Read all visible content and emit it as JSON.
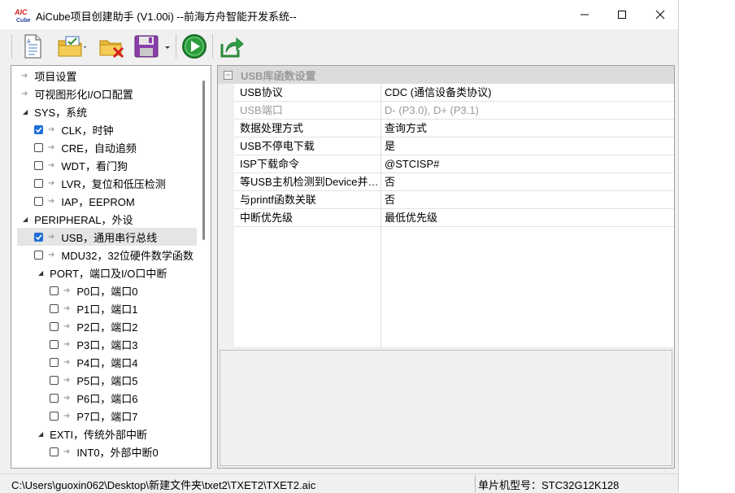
{
  "window": {
    "logo_text": "AIC Cube",
    "title": "AiCube项目创建助手 (V1.00i) --前海方舟智能开发系统--",
    "controls": [
      "minimize",
      "maximize",
      "close"
    ]
  },
  "toolbar": {
    "buttons": [
      {
        "icon": "new-document-icon"
      },
      {
        "icon": "open-folder-icon"
      },
      {
        "icon": "delete-folder-icon"
      },
      {
        "icon": "save-disk-icon"
      },
      {
        "icon": "run-play-icon"
      },
      {
        "icon": "export-share-icon"
      }
    ]
  },
  "tree": {
    "items": [
      {
        "label": "项目设置"
      },
      {
        "label": "可视图形化I/O口配置"
      },
      {
        "label": "SYS，系统"
      },
      {
        "label": "CLK，时钟",
        "checked": true
      },
      {
        "label": "CRE，自动追频",
        "checked": false
      },
      {
        "label": "WDT，看门狗",
        "checked": false
      },
      {
        "label": "LVR，复位和低压检测",
        "checked": false
      },
      {
        "label": "IAP，EEPROM",
        "checked": false
      },
      {
        "label": "PERIPHERAL，外设"
      },
      {
        "label": "USB，通用串行总线",
        "checked": true
      },
      {
        "label": "MDU32，32位硬件数学函数",
        "checked": false
      },
      {
        "label": "PORT，端口及I/O口中断"
      },
      {
        "label": "P0口，端口0",
        "checked": false
      },
      {
        "label": "P1口，端口1",
        "checked": false
      },
      {
        "label": "P2口，端口2",
        "checked": false
      },
      {
        "label": "P3口，端口3",
        "checked": false
      },
      {
        "label": "P4口，端口4",
        "checked": false
      },
      {
        "label": "P5口，端口5",
        "checked": false
      },
      {
        "label": "P6口，端口6",
        "checked": false
      },
      {
        "label": "P7口，端口7",
        "checked": false
      },
      {
        "label": "EXTI，传统外部中断"
      },
      {
        "label": "INT0，外部中断0",
        "checked": false
      }
    ]
  },
  "properties": {
    "category": "USB库函数设置",
    "rows": [
      {
        "name": "USB协议",
        "value": "CDC (通信设备类协议)",
        "disabled": false
      },
      {
        "name": "USB端口",
        "value": "D- (P3.0), D+ (P3.1)",
        "disabled": true
      },
      {
        "name": "数据处理方式",
        "value": "查询方式",
        "disabled": false
      },
      {
        "name": "USB不停电下载",
        "value": "是",
        "disabled": false
      },
      {
        "name": "ISP下载命令",
        "value": "@STCISP#",
        "disabled": false
      },
      {
        "name": "等USB主机检测到Device并…",
        "value": "否",
        "disabled": false
      },
      {
        "name": "与printf函数关联",
        "value": "否",
        "disabled": false
      },
      {
        "name": "中断优先级",
        "value": "最低优先级",
        "disabled": false
      }
    ]
  },
  "status": {
    "path": "C:\\Users\\guoxin062\\Desktop\\新建文件夹\\txet2\\TXET2\\TXET2.aic",
    "mcu": "单片机型号：STC32G12K128"
  }
}
